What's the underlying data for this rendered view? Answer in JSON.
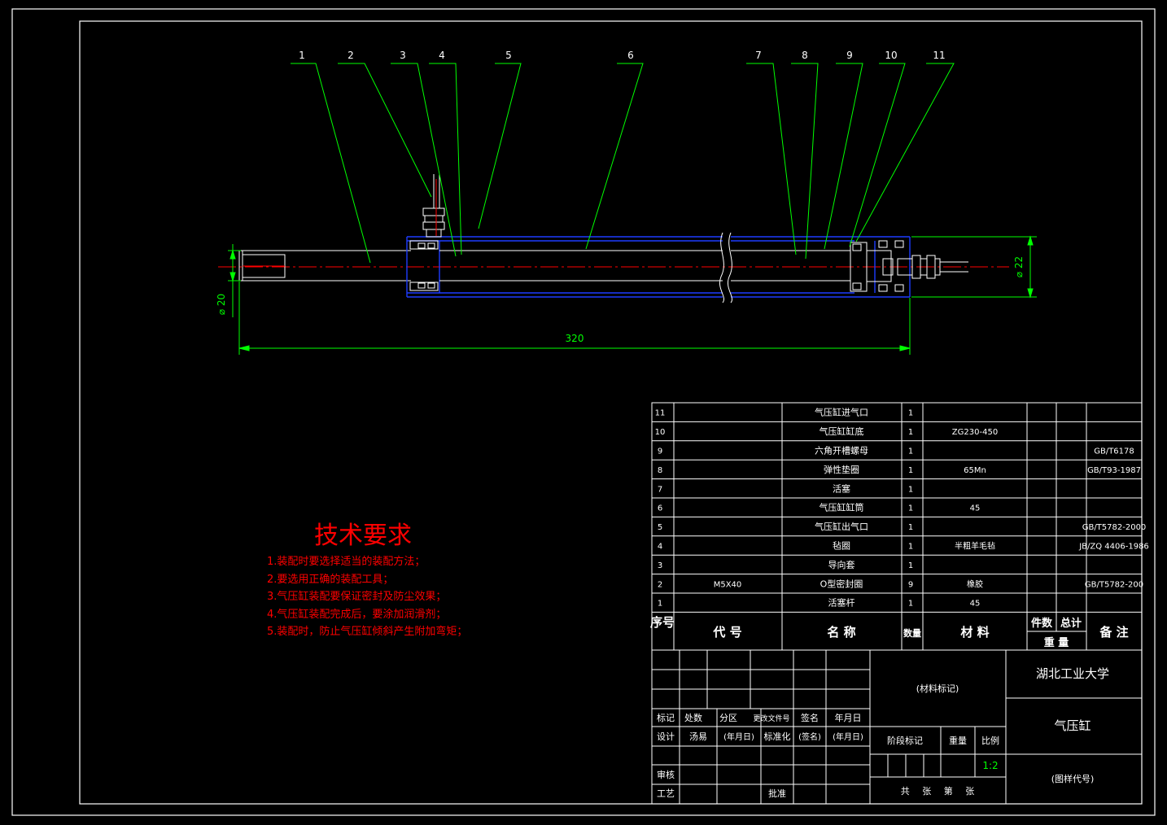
{
  "colors": {
    "background": "#000000",
    "frame": "#ffffff",
    "leader": "#00ff00",
    "centerline": "#ff0000",
    "part": "#0000ff",
    "text": "#ffffff",
    "requirements": "#ff0000"
  },
  "part_callouts": [
    "1",
    "2",
    "3",
    "4",
    "5",
    "6",
    "7",
    "8",
    "9",
    "10",
    "11"
  ],
  "dimensions": {
    "overall_length": "320",
    "rod_diameter": "⌀ 20",
    "barrel_diameter": "⌀ 22"
  },
  "technical_requirements": {
    "title": "技术要求",
    "items": [
      "1.装配时要选择适当的装配方法；",
      "2.要选用正确的装配工具；",
      "3.气压缸装配要保证密封及防尘效果；",
      "4.气压缸装配完成后，要涂加润滑剂；",
      "5.装配时，防止气压缸倾斜产生附加弯矩；"
    ]
  },
  "parts_list": {
    "rows": [
      {
        "no": "11",
        "code": "",
        "name": "气压缸进气口",
        "qty": "1",
        "material": "",
        "note": ""
      },
      {
        "no": "10",
        "code": "",
        "name": "气压缸缸底",
        "qty": "1",
        "material": "ZG230-450",
        "note": ""
      },
      {
        "no": "9",
        "code": "",
        "name": "六角开槽螺母",
        "qty": "1",
        "material": "",
        "note": "GB/T6178"
      },
      {
        "no": "8",
        "code": "",
        "name": "弹性垫圈",
        "qty": "1",
        "material": "65Mn",
        "note": "GB/T93-1987"
      },
      {
        "no": "7",
        "code": "",
        "name": "活塞",
        "qty": "1",
        "material": "",
        "note": ""
      },
      {
        "no": "6",
        "code": "",
        "name": "气压缸缸筒",
        "qty": "1",
        "material": "45",
        "note": ""
      },
      {
        "no": "5",
        "code": "",
        "name": "气压缸出气口",
        "qty": "1",
        "material": "",
        "note": "GB/T5782-2000"
      },
      {
        "no": "4",
        "code": "",
        "name": "毡圈",
        "qty": "1",
        "material": "半粗羊毛毡",
        "note": "JB/ZQ 4406-1986"
      },
      {
        "no": "3",
        "code": "",
        "name": "导向套",
        "qty": "1",
        "material": "",
        "note": ""
      },
      {
        "no": "2",
        "code": "M5X40",
        "name": "O型密封圈",
        "qty": "9",
        "material": "橡胶",
        "note": "GB/T5782-200"
      },
      {
        "no": "1",
        "code": "",
        "name": "活塞杆",
        "qty": "1",
        "material": "45",
        "note": ""
      }
    ],
    "headers": {
      "no": "序号",
      "code": "代 号",
      "name": "名 称",
      "qty": "数量",
      "material": "材 料",
      "single_weight": "件数",
      "total_weight": "总计",
      "weight": "重 量",
      "note": "备 注"
    }
  },
  "title_block": {
    "material_mark": "(材料标记)",
    "school": "湖北工业大学",
    "drawing_name": "气压缸",
    "drawing_code": "(图样代号)",
    "stage_mark": "阶段标记",
    "weight": "重量",
    "scale_label": "比例",
    "scale_value": "1:2",
    "sheets": "共 张 第 张",
    "revision_headers": [
      "标记",
      "处数",
      "分区",
      "更改文件号",
      "签名",
      "年月日"
    ],
    "design": "设计",
    "designer": "汤易",
    "date1": "(年月日)",
    "standardize": "标准化",
    "signature": "(签名)",
    "date2": "(年月日)",
    "review": "审核",
    "process": "工艺",
    "approve": "批准"
  }
}
